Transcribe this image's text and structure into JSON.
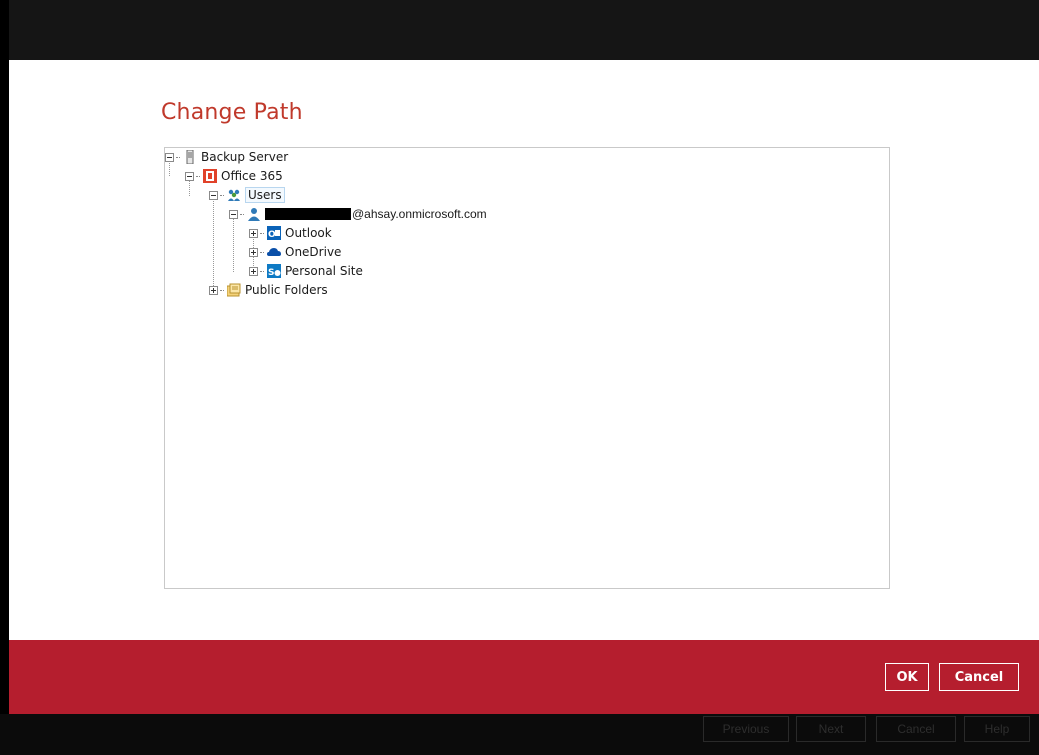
{
  "dialog": {
    "title": "Change Path"
  },
  "tree": {
    "backup_server": "Backup Server",
    "office365": "Office 365",
    "users": "Users",
    "user_email_suffix": "@ahsay.onmicrosoft.com",
    "outlook": "Outlook",
    "onedrive": "OneDrive",
    "personal_site": "Personal Site",
    "public_folders": "Public Folders"
  },
  "footer": {
    "ok_label": "OK",
    "cancel_label": "Cancel"
  },
  "background_nav": {
    "previous": "Previous",
    "next": "Next",
    "cancel": "Cancel",
    "help": "Help"
  },
  "icons": {
    "server": "server-icon",
    "office365": "office365-icon",
    "users": "users-icon",
    "user": "user-icon",
    "outlook": "outlook-icon",
    "onedrive": "onedrive-icon",
    "sharepoint": "sharepoint-icon",
    "public_folders": "public-folders-icon"
  },
  "colors": {
    "accent": "#c0392b",
    "footer": "#b51e2e",
    "top_bar": "#151515"
  }
}
